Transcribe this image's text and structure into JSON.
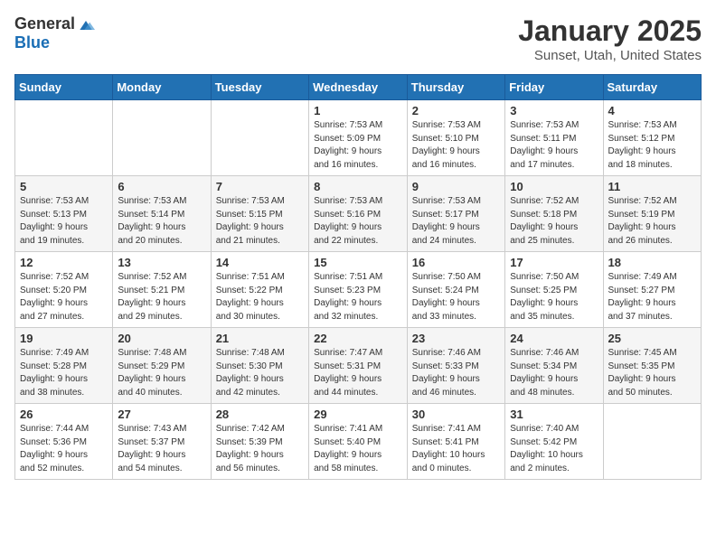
{
  "header": {
    "logo_general": "General",
    "logo_blue": "Blue",
    "month": "January 2025",
    "location": "Sunset, Utah, United States"
  },
  "weekdays": [
    "Sunday",
    "Monday",
    "Tuesday",
    "Wednesday",
    "Thursday",
    "Friday",
    "Saturday"
  ],
  "weeks": [
    [
      {
        "day": "",
        "info": ""
      },
      {
        "day": "",
        "info": ""
      },
      {
        "day": "",
        "info": ""
      },
      {
        "day": "1",
        "info": "Sunrise: 7:53 AM\nSunset: 5:09 PM\nDaylight: 9 hours\nand 16 minutes."
      },
      {
        "day": "2",
        "info": "Sunrise: 7:53 AM\nSunset: 5:10 PM\nDaylight: 9 hours\nand 16 minutes."
      },
      {
        "day": "3",
        "info": "Sunrise: 7:53 AM\nSunset: 5:11 PM\nDaylight: 9 hours\nand 17 minutes."
      },
      {
        "day": "4",
        "info": "Sunrise: 7:53 AM\nSunset: 5:12 PM\nDaylight: 9 hours\nand 18 minutes."
      }
    ],
    [
      {
        "day": "5",
        "info": "Sunrise: 7:53 AM\nSunset: 5:13 PM\nDaylight: 9 hours\nand 19 minutes."
      },
      {
        "day": "6",
        "info": "Sunrise: 7:53 AM\nSunset: 5:14 PM\nDaylight: 9 hours\nand 20 minutes."
      },
      {
        "day": "7",
        "info": "Sunrise: 7:53 AM\nSunset: 5:15 PM\nDaylight: 9 hours\nand 21 minutes."
      },
      {
        "day": "8",
        "info": "Sunrise: 7:53 AM\nSunset: 5:16 PM\nDaylight: 9 hours\nand 22 minutes."
      },
      {
        "day": "9",
        "info": "Sunrise: 7:53 AM\nSunset: 5:17 PM\nDaylight: 9 hours\nand 24 minutes."
      },
      {
        "day": "10",
        "info": "Sunrise: 7:52 AM\nSunset: 5:18 PM\nDaylight: 9 hours\nand 25 minutes."
      },
      {
        "day": "11",
        "info": "Sunrise: 7:52 AM\nSunset: 5:19 PM\nDaylight: 9 hours\nand 26 minutes."
      }
    ],
    [
      {
        "day": "12",
        "info": "Sunrise: 7:52 AM\nSunset: 5:20 PM\nDaylight: 9 hours\nand 27 minutes."
      },
      {
        "day": "13",
        "info": "Sunrise: 7:52 AM\nSunset: 5:21 PM\nDaylight: 9 hours\nand 29 minutes."
      },
      {
        "day": "14",
        "info": "Sunrise: 7:51 AM\nSunset: 5:22 PM\nDaylight: 9 hours\nand 30 minutes."
      },
      {
        "day": "15",
        "info": "Sunrise: 7:51 AM\nSunset: 5:23 PM\nDaylight: 9 hours\nand 32 minutes."
      },
      {
        "day": "16",
        "info": "Sunrise: 7:50 AM\nSunset: 5:24 PM\nDaylight: 9 hours\nand 33 minutes."
      },
      {
        "day": "17",
        "info": "Sunrise: 7:50 AM\nSunset: 5:25 PM\nDaylight: 9 hours\nand 35 minutes."
      },
      {
        "day": "18",
        "info": "Sunrise: 7:49 AM\nSunset: 5:27 PM\nDaylight: 9 hours\nand 37 minutes."
      }
    ],
    [
      {
        "day": "19",
        "info": "Sunrise: 7:49 AM\nSunset: 5:28 PM\nDaylight: 9 hours\nand 38 minutes."
      },
      {
        "day": "20",
        "info": "Sunrise: 7:48 AM\nSunset: 5:29 PM\nDaylight: 9 hours\nand 40 minutes."
      },
      {
        "day": "21",
        "info": "Sunrise: 7:48 AM\nSunset: 5:30 PM\nDaylight: 9 hours\nand 42 minutes."
      },
      {
        "day": "22",
        "info": "Sunrise: 7:47 AM\nSunset: 5:31 PM\nDaylight: 9 hours\nand 44 minutes."
      },
      {
        "day": "23",
        "info": "Sunrise: 7:46 AM\nSunset: 5:33 PM\nDaylight: 9 hours\nand 46 minutes."
      },
      {
        "day": "24",
        "info": "Sunrise: 7:46 AM\nSunset: 5:34 PM\nDaylight: 9 hours\nand 48 minutes."
      },
      {
        "day": "25",
        "info": "Sunrise: 7:45 AM\nSunset: 5:35 PM\nDaylight: 9 hours\nand 50 minutes."
      }
    ],
    [
      {
        "day": "26",
        "info": "Sunrise: 7:44 AM\nSunset: 5:36 PM\nDaylight: 9 hours\nand 52 minutes."
      },
      {
        "day": "27",
        "info": "Sunrise: 7:43 AM\nSunset: 5:37 PM\nDaylight: 9 hours\nand 54 minutes."
      },
      {
        "day": "28",
        "info": "Sunrise: 7:42 AM\nSunset: 5:39 PM\nDaylight: 9 hours\nand 56 minutes."
      },
      {
        "day": "29",
        "info": "Sunrise: 7:41 AM\nSunset: 5:40 PM\nDaylight: 9 hours\nand 58 minutes."
      },
      {
        "day": "30",
        "info": "Sunrise: 7:41 AM\nSunset: 5:41 PM\nDaylight: 10 hours\nand 0 minutes."
      },
      {
        "day": "31",
        "info": "Sunrise: 7:40 AM\nSunset: 5:42 PM\nDaylight: 10 hours\nand 2 minutes."
      },
      {
        "day": "",
        "info": ""
      }
    ]
  ]
}
